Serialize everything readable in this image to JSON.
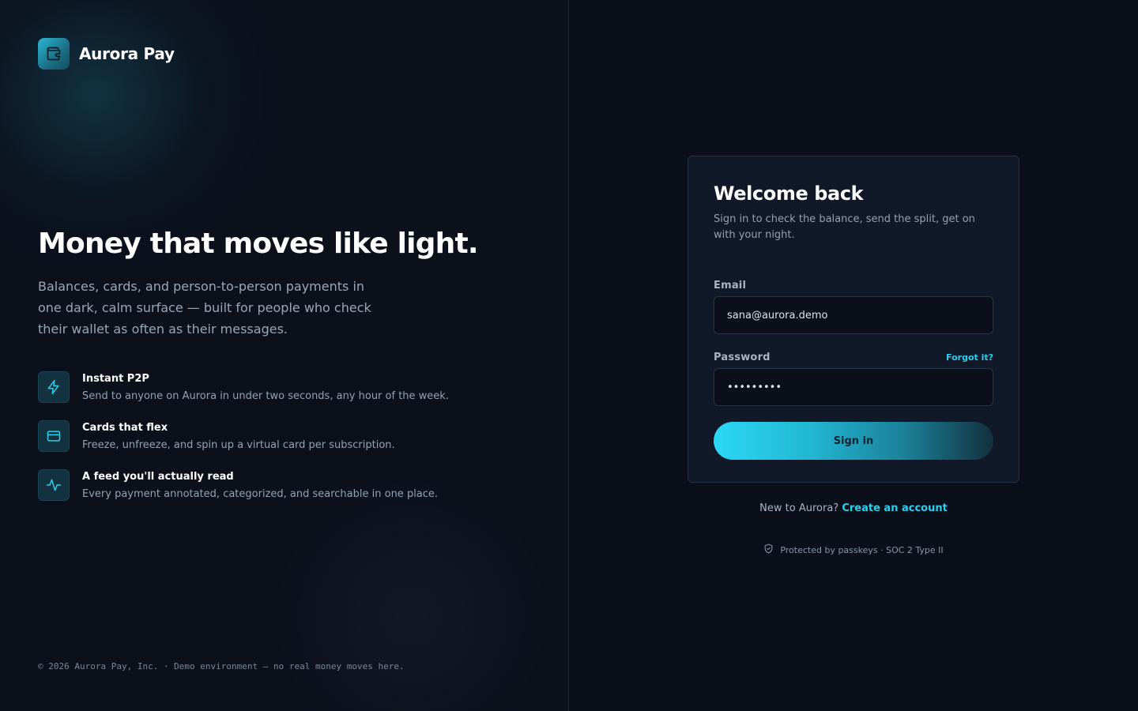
{
  "brand": {
    "name": "Aurora Pay",
    "icon": "wallet-icon"
  },
  "hero": {
    "title": "Money that moves like light.",
    "subtitle": "Balances, cards, and person-to-person payments in one dark, calm surface — built for people who check their wallet as often as their messages."
  },
  "features": [
    {
      "icon": "lightning-icon",
      "title": "Instant P2P",
      "desc": "Send to anyone on Aurora in under two seconds, any hour of the week."
    },
    {
      "icon": "card-icon",
      "title": "Cards that flex",
      "desc": "Freeze, unfreeze, and spin up a virtual card per subscription."
    },
    {
      "icon": "activity-icon",
      "title": "A feed you'll actually read",
      "desc": "Every payment annotated, categorized, and searchable in one place."
    }
  ],
  "footer": {
    "note": "© 2026 Aurora Pay, Inc. · Demo environment — no real money moves here."
  },
  "login": {
    "title": "Welcome back",
    "subtitle": "Sign in to check the balance, send the split, get on with your night.",
    "email_label": "Email",
    "email_value": "sana@aurora.demo",
    "password_label": "Password",
    "password_value": "demo-pass",
    "forgot_label": "Forgot it?",
    "signin_label": "Sign in",
    "new_prefix": "New to Aurora?",
    "create_label": "Create an account",
    "protected_text": "Protected by passkeys · SOC 2 Type II"
  },
  "colors": {
    "accent": "#2ad0ee",
    "background": "#0a0f1a",
    "card": "#111827"
  }
}
